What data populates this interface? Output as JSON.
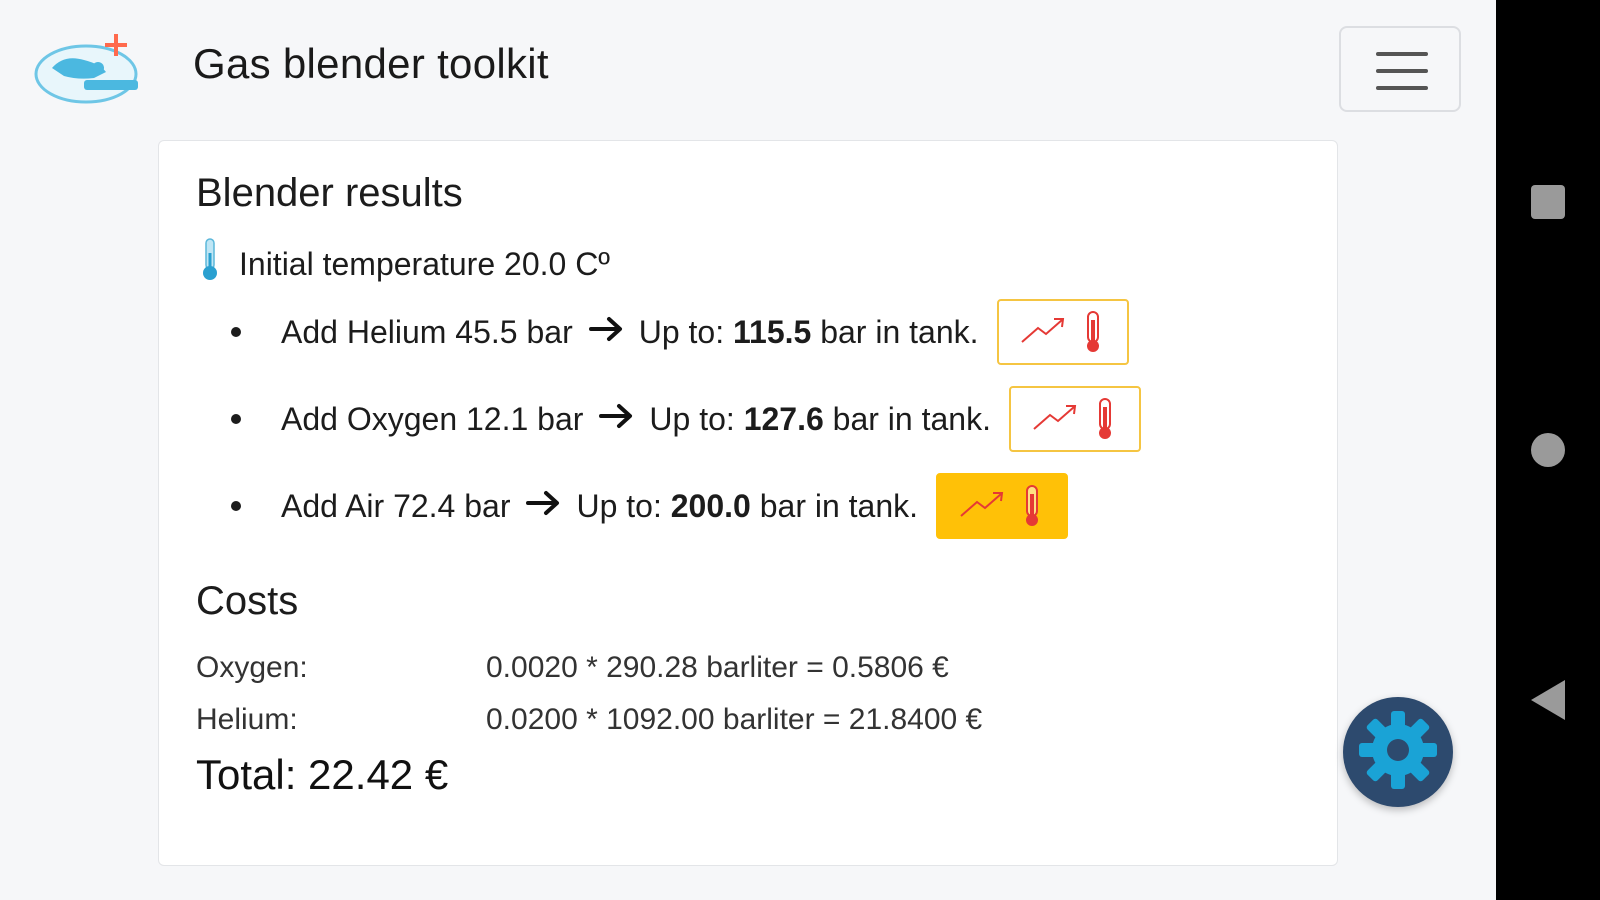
{
  "header": {
    "title": "Gas blender toolkit"
  },
  "results": {
    "title": "Blender results",
    "initial_temperature": "Initial temperature 20.0 Cº",
    "steps": [
      {
        "prefix": "Add Helium 45.5 bar",
        "upto_label": "Up to: ",
        "upto_value": "115.5",
        "suffix": " bar in tank."
      },
      {
        "prefix": "Add Oxygen 12.1 bar",
        "upto_label": "Up to: ",
        "upto_value": "127.6",
        "suffix": " bar in tank."
      },
      {
        "prefix": "Add Air 72.4 bar",
        "upto_label": "Up to: ",
        "upto_value": "200.0",
        "suffix": " bar in tank."
      }
    ]
  },
  "costs": {
    "title": "Costs",
    "rows": [
      {
        "label": "Oxygen:",
        "formula": "0.0020 * 290.28 barliter = 0.5806 €"
      },
      {
        "label": "Helium:",
        "formula": "0.0200 * 1092.00 barliter = 21.8400 €"
      }
    ],
    "total": "Total: 22.42 €"
  },
  "colors": {
    "accent_yellow": "#ffc107",
    "fab_blue": "#2d4a6e",
    "fab_gear": "#1aa3d6"
  }
}
